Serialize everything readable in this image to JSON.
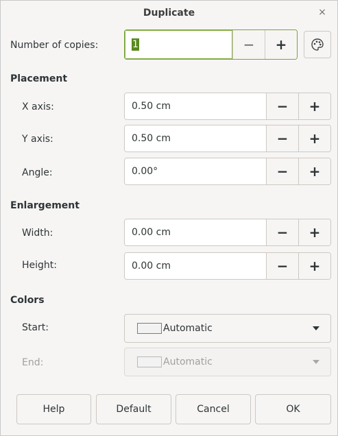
{
  "window": {
    "title": "Duplicate",
    "close_glyph": "×"
  },
  "copies": {
    "label": "Number of copies:",
    "value": "1",
    "minus": "−",
    "plus": "+"
  },
  "placement": {
    "heading": "Placement",
    "x_axis": {
      "label": "X axis:",
      "value": "0.50 cm"
    },
    "y_axis": {
      "label": "Y axis:",
      "value": "0.50 cm"
    },
    "angle": {
      "label": "Angle:",
      "value": "0.00°"
    }
  },
  "enlargement": {
    "heading": "Enlargement",
    "width": {
      "label": "Width:",
      "value": "0.00 cm"
    },
    "height": {
      "label": "Height:",
      "value": "0.00 cm"
    }
  },
  "colors": {
    "heading": "Colors",
    "start": {
      "label": "Start:",
      "value": "Automatic"
    },
    "end": {
      "label": "End:",
      "value": "Automatic"
    }
  },
  "spin_glyphs": {
    "minus": "−",
    "plus": "+"
  },
  "buttons": {
    "help": "Help",
    "default": "Default",
    "cancel": "Cancel",
    "ok": "OK"
  },
  "icons": {
    "values_from_selection": "palette-icon"
  }
}
